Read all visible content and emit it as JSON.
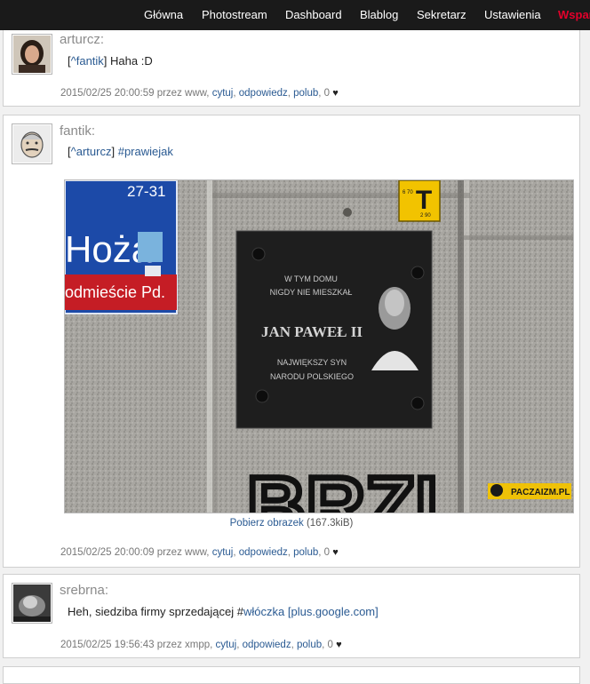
{
  "nav": {
    "items": [
      "Główna",
      "Photostream",
      "Dashboard",
      "Blablog",
      "Sekretarz",
      "Ustawienia"
    ],
    "highlight": "Wspar"
  },
  "entries": [
    {
      "author": "arturcz:",
      "reply_open": "[",
      "reply_user": "^fantik",
      "reply_close": "]",
      "text": "Haha :D",
      "timestamp": "2015/02/25 20:00:59 przez www,",
      "actions": [
        "cytuj",
        "odpowiedz",
        "polub"
      ],
      "likes": "0"
    },
    {
      "author": "fantik:",
      "reply_open": "[",
      "reply_user": "^arturcz",
      "reply_close": "]",
      "tag": "#prawiejak",
      "image": {
        "street_sign_number": "27-31",
        "street_sign_name": "Hoża",
        "street_sign_district": "odmieście Pd.",
        "plaque_line1": "W TYM DOMU",
        "plaque_line2": "NIGDY NIE MIESZKAŁ",
        "plaque_name": "JAN PAWEŁ II",
        "plaque_line3": "NAJWIĘKSZY SYN",
        "plaque_line4": "NARODU POLSKIEGO",
        "watermark": "PACZAIZM.PL",
        "graffiti": "BRZI",
        "yellow_sign_letter": "T",
        "yellow_sign_small_top": "6 70",
        "yellow_sign_small_bottom": "2 90"
      },
      "download_link": "Pobierz obrazek",
      "download_size": "(167.3kiB)",
      "timestamp": "2015/02/25 20:00:09 przez www,",
      "actions": [
        "cytuj",
        "odpowiedz",
        "polub"
      ],
      "likes": "0"
    },
    {
      "author": "srebrna:",
      "text_prefix": "Heh, siedziba firmy sprzedającej #",
      "tag": "włóczka",
      "link": "[plus.google.com]",
      "timestamp": "2015/02/25 19:56:43 przez xmpp,",
      "actions": [
        "cytuj",
        "odpowiedz",
        "polub"
      ],
      "likes": "0"
    }
  ]
}
